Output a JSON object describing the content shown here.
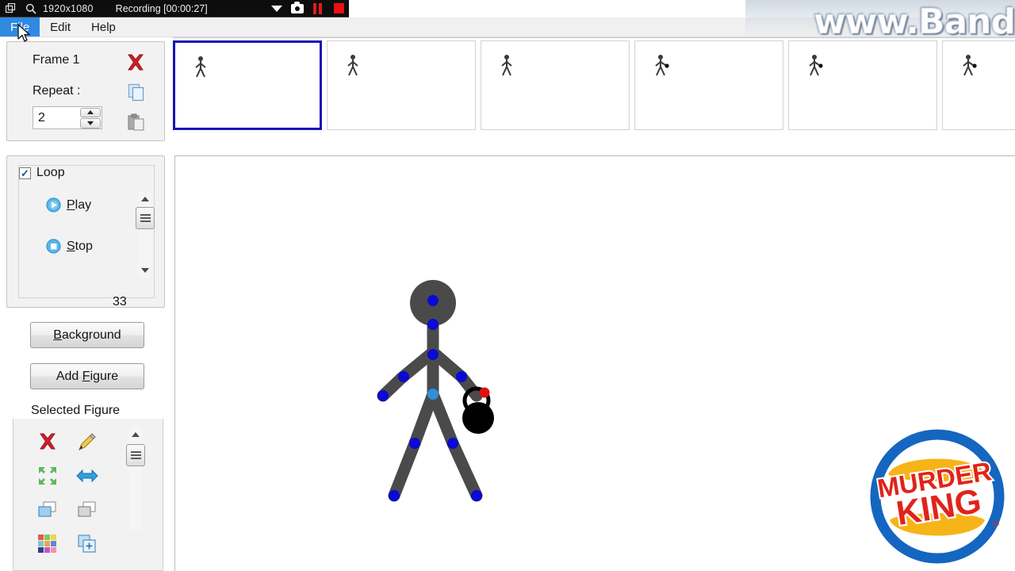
{
  "recorder_bar": {
    "resolution": "1920x1080",
    "status": "Recording [00:00:27]",
    "icons": [
      "window-icon",
      "magnifier-icon",
      "chevron-down-icon",
      "camera-icon",
      "pause-icon",
      "stop-icon"
    ]
  },
  "watermark": {
    "text": "www.Band"
  },
  "menubar": {
    "items": [
      {
        "label": "File",
        "active": true
      },
      {
        "label": "Edit",
        "active": false
      },
      {
        "label": "Help",
        "active": false
      }
    ]
  },
  "frame_panel": {
    "frame_label": "Frame 1",
    "repeat_label": "Repeat :",
    "repeat_value": "2",
    "delete_icon": "red-x-icon",
    "copy_icon": "copy-icon",
    "paste_icon": "paste-icon"
  },
  "playback": {
    "play_label": "Play",
    "play_accel": "P",
    "stop_label": "Stop",
    "stop_accel": "S",
    "loop_label": "Loop",
    "loop_checked": true,
    "check_glyph": "✓",
    "frame_count": "33"
  },
  "buttons": {
    "background": "Background",
    "background_accel": "B",
    "add_figure": "Add Figure",
    "add_figure_accel": "F"
  },
  "selected_figure": {
    "legend": "Selected Figure",
    "tools": [
      {
        "name": "delete-figure-icon",
        "glyph": "✖",
        "color": "#d42027"
      },
      {
        "name": "edit-figure-icon",
        "glyph": "✎",
        "color": "#e8a81c"
      },
      {
        "name": "scale-figure-icon",
        "glyph": "⤡",
        "color": "#56b556"
      },
      {
        "name": "flip-figure-icon",
        "glyph": "⬌",
        "color": "#2f9fe0"
      },
      {
        "name": "bring-forward-icon",
        "glyph": "⧉",
        "color": "#7fb8e0"
      },
      {
        "name": "send-backward-icon",
        "glyph": "⧉",
        "color": "#9a9a9a"
      },
      {
        "name": "color-palette-icon",
        "glyph": "▦",
        "color": "#cc4444"
      },
      {
        "name": "duplicate-figure-icon",
        "glyph": "⊞",
        "color": "#7fb8e0"
      }
    ]
  },
  "frame_strip": {
    "frames": [
      {
        "index": 1,
        "selected": true,
        "has_object": false
      },
      {
        "index": 2,
        "selected": false,
        "has_object": false
      },
      {
        "index": 3,
        "selected": false,
        "has_object": false
      },
      {
        "index": 4,
        "selected": false,
        "has_object": true
      },
      {
        "index": 5,
        "selected": false,
        "has_object": true
      },
      {
        "index": 6,
        "selected": false,
        "has_object": true
      }
    ]
  },
  "canvas": {
    "figure": {
      "body_color": "#4a4a4a",
      "joint_color": "#0a0ad2",
      "hip_joint_color": "#2f8fd8",
      "object_color": "#000000",
      "object_accent_color": "#e01010"
    }
  },
  "brand_logo": {
    "line1": "MURDER",
    "line2": "KING",
    "registered": "®",
    "ring_color": "#1566c0",
    "bun_color": "#f7b418",
    "text_color": "#e2231a"
  }
}
